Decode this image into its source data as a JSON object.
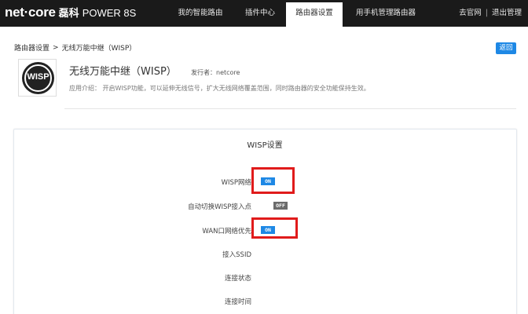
{
  "header": {
    "brand": "net·core",
    "brand_cn": "磊科",
    "model": "POWER 8S",
    "tabs": [
      {
        "label": "我的智能路由"
      },
      {
        "label": "插件中心"
      },
      {
        "label": "路由器设置",
        "active": true
      },
      {
        "label": "用手机管理路由器"
      }
    ],
    "links": {
      "official_site": "去官网",
      "separator": "|",
      "logout": "退出管理"
    }
  },
  "breadcrumb": {
    "parent": "路由器设置",
    "arrow": ">",
    "current": "无线万能中继（WISP）"
  },
  "back_label": "返回",
  "plugin": {
    "icon_text": "WISP",
    "title": "无线万能中继（WISP）",
    "publisher": "发行者：netcore",
    "description": "应用介绍： 开启WISP功能，可以延伸无线信号，扩大无线网络覆盖范围，同时路由器的安全功能保持生效。"
  },
  "settings": {
    "title": "WISP设置",
    "rows": [
      {
        "label": "WISP网络",
        "toggle": "ON",
        "state": "on"
      },
      {
        "label": "自动切换WISP接入点",
        "toggle": "OFF",
        "state": "off"
      },
      {
        "label": "WAN口网络优先",
        "toggle": "ON",
        "state": "on"
      },
      {
        "label": "接入SSID"
      },
      {
        "label": "连接状态"
      },
      {
        "label": "连接时间"
      }
    ]
  },
  "colors": {
    "topbar": "#1a1a1a",
    "accent": "#1e88e5",
    "toggle_off": "#6b6b6b",
    "highlight": "#e01b1b"
  }
}
